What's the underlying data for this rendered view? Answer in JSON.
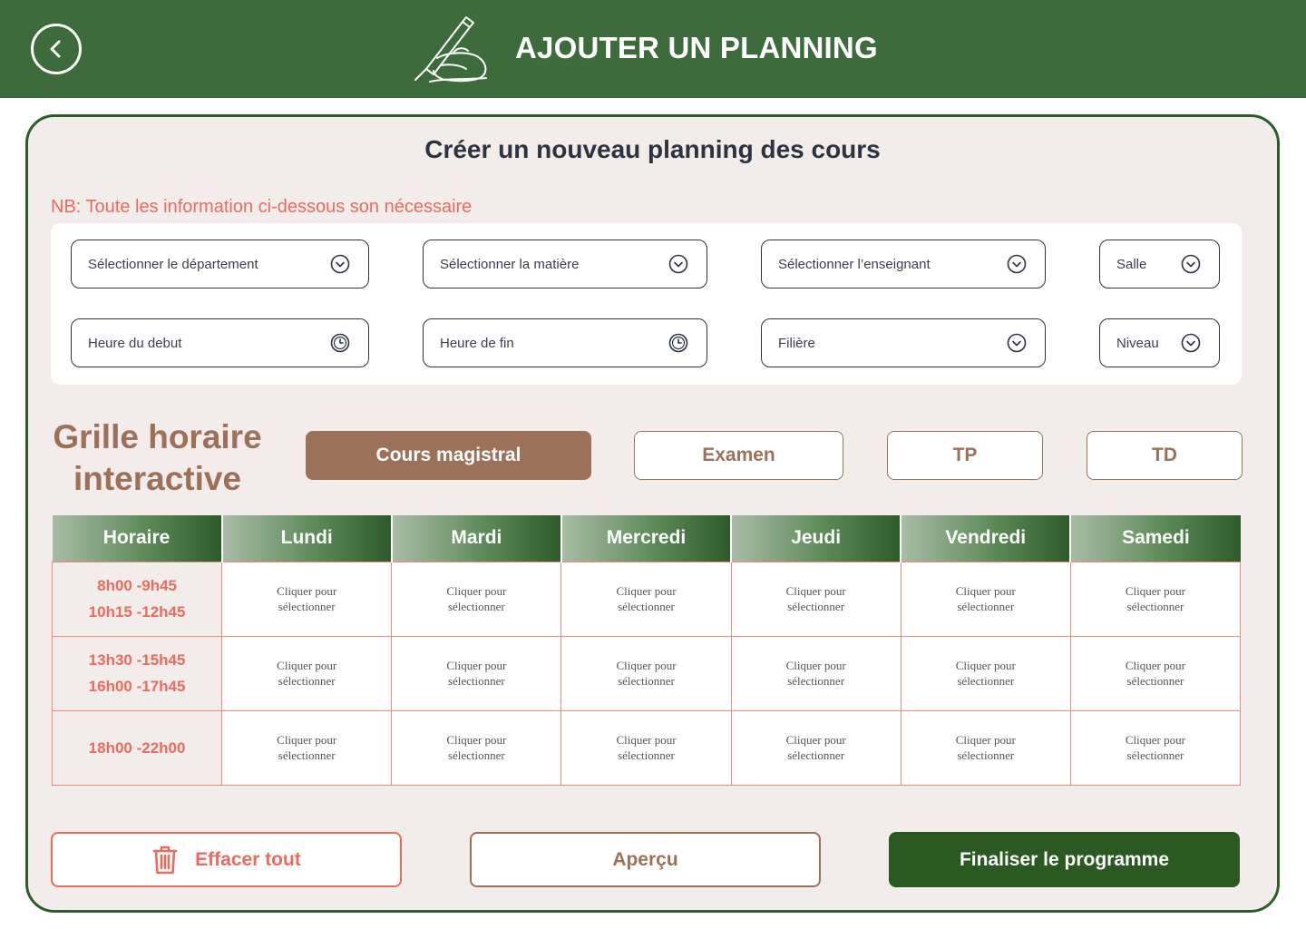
{
  "header": {
    "title": "AJOUTER UN PLANNING",
    "back_icon": "chevron-left-icon",
    "logo_icon": "hand-writing-pen-icon"
  },
  "card": {
    "title": "Créer un nouveau planning des cours",
    "note": "NB: Toute les information ci-dessous son nécessaire"
  },
  "form": {
    "department": "Sélectionner le département",
    "subject": "Sélectionner la matière",
    "teacher": "Sélectionner l’enseignant",
    "room": "Salle",
    "start_time": "Heure du debut",
    "end_time": "Heure de fin",
    "field_of_study": "Filière",
    "level": "Niveau"
  },
  "grid": {
    "title_line1": "Grille horaire",
    "title_line2": "interactive",
    "types": [
      "Cours magistral",
      "Examen",
      "TP",
      "TD"
    ],
    "active_type": "Cours magistral"
  },
  "timetable": {
    "headers": [
      "Horaire",
      "Lundi",
      "Mardi",
      "Mercredi",
      "Jeudi",
      "Vendredi",
      "Samedi"
    ],
    "rows": [
      {
        "times": [
          "8h00 -9h45",
          "10h15 -12h45"
        ]
      },
      {
        "times": [
          "13h30 -15h45",
          "16h00 -17h45"
        ]
      },
      {
        "times": [
          "18h00 -22h00"
        ]
      }
    ],
    "slot_line1": "Cliquer pour",
    "slot_line2": "sélectionner"
  },
  "actions": {
    "clear": "Effacer tout",
    "preview": "Aperçu",
    "finalize": "Finaliser le programme"
  },
  "colors": {
    "header_green": "#3d6b3b",
    "dark_green": "#2a5a22",
    "brown_accent": "#9b7259",
    "coral": "#ea6b5f",
    "card_bg": "#f2ecea"
  }
}
